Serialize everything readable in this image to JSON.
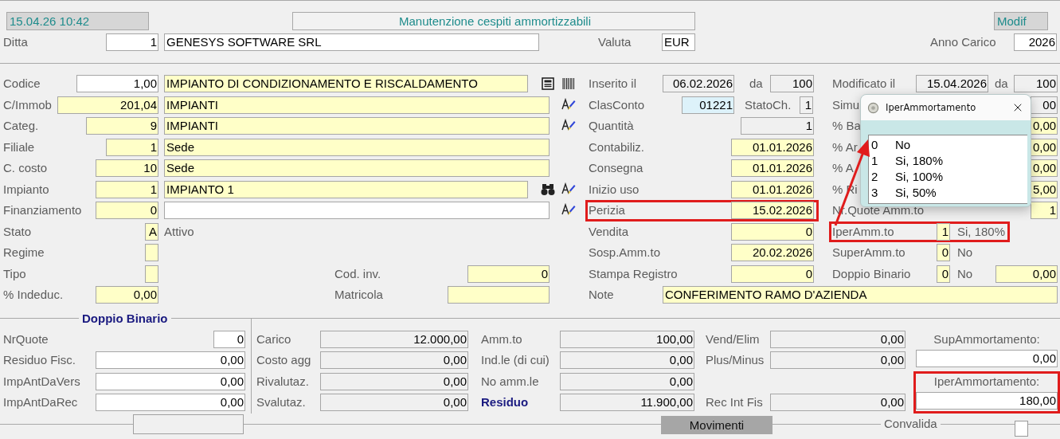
{
  "header": {
    "timestamp": "15.04.26 10:42",
    "title": "Manutenzione cespiti ammortizzabili",
    "mode": "Modif"
  },
  "company": {
    "label": "Ditta",
    "code": "1",
    "name": "GENESYS SOFTWARE SRL",
    "currency_label": "Valuta",
    "currency": "EUR",
    "year_label": "Anno Carico",
    "year": "2026"
  },
  "rows": [
    {
      "left": {
        "highlighted": false,
        "items": [
          {
            "kind": "label",
            "text": "Codice"
          },
          {
            "kind": "key_field",
            "value": "1,00"
          },
          {
            "kind": "input_field",
            "value": "IMPIANTO DI CONDIZIONAMENTO E RISCALDAMENTO"
          },
          {
            "kind": "detail_button"
          },
          {
            "kind": "barcode_button"
          }
        ]
      },
      "middle": {
        "highlighted": false,
        "items": [
          {
            "kind": "label",
            "text": "Inserito il"
          },
          {
            "kind": "readonly_field",
            "value": "06.02.2026"
          },
          {
            "kind": "label",
            "text": "da"
          },
          {
            "kind": "readonly_field",
            "value": "100"
          }
        ]
      },
      "right": {
        "highlighted": false,
        "items": [
          {
            "kind": "label",
            "text": "Modificato il"
          },
          {
            "kind": "readonly_field",
            "value": "15.04.2026"
          },
          {
            "kind": "label",
            "text": "da"
          },
          {
            "kind": "readonly_field",
            "value": "100"
          }
        ]
      }
    },
    {
      "left": {
        "highlighted": false,
        "items": [
          {
            "kind": "label",
            "text": "C/Immob"
          },
          {
            "kind": "input_field",
            "value": "201,04"
          },
          {
            "kind": "input_field",
            "value": "IMPIANTI"
          },
          {
            "kind": "lookup_button"
          }
        ]
      },
      "middle": {
        "highlighted": false,
        "items": [
          {
            "kind": "label",
            "text": "ClasConto"
          },
          {
            "kind": "linked_field",
            "value": "01221"
          },
          {
            "kind": "label",
            "text": "StatoCh."
          },
          {
            "kind": "readonly_field",
            "value": "1"
          }
        ]
      },
      "right": {
        "highlighted": false,
        "items": [
          {
            "kind": "label",
            "text": "Simu"
          },
          {
            "kind": "readonly_field",
            "value": "00"
          }
        ]
      }
    },
    {
      "left": {
        "highlighted": false,
        "items": [
          {
            "kind": "label",
            "text": "Categ."
          },
          {
            "kind": "input_field",
            "value": "9"
          },
          {
            "kind": "input_field",
            "value": "IMPIANTI"
          },
          {
            "kind": "lookup_button"
          }
        ]
      },
      "middle": {
        "highlighted": false,
        "items": [
          {
            "kind": "label",
            "text": "Quantità"
          },
          {
            "kind": "readonly_field",
            "value": "1"
          }
        ]
      },
      "right": {
        "highlighted": false,
        "items": [
          {
            "kind": "label",
            "text": "% Ba"
          },
          {
            "kind": "input_field",
            "value": "0,00"
          }
        ]
      }
    },
    {
      "left": {
        "highlighted": false,
        "items": [
          {
            "kind": "label",
            "text": "Filiale"
          },
          {
            "kind": "input_field",
            "value": "1"
          },
          {
            "kind": "input_field",
            "value": "Sede"
          }
        ]
      },
      "middle": {
        "highlighted": false,
        "items": [
          {
            "kind": "label",
            "text": "Contabiliz."
          },
          {
            "kind": "input_field",
            "value": "01.01.2026"
          }
        ]
      },
      "right": {
        "highlighted": false,
        "items": [
          {
            "kind": "label",
            "text": "% Ar"
          },
          {
            "kind": "input_field",
            "value": "0,00"
          }
        ]
      }
    },
    {
      "left": {
        "highlighted": false,
        "items": [
          {
            "kind": "label",
            "text": "C. costo"
          },
          {
            "kind": "input_field",
            "value": "10"
          },
          {
            "kind": "input_field",
            "value": "Sede"
          }
        ]
      },
      "middle": {
        "highlighted": false,
        "items": [
          {
            "kind": "label",
            "text": "Consegna"
          },
          {
            "kind": "input_field",
            "value": "01.01.2026"
          }
        ]
      },
      "right": {
        "highlighted": false,
        "items": [
          {
            "kind": "label",
            "text": "% A"
          },
          {
            "kind": "input_field",
            "value": "0,00"
          }
        ]
      }
    },
    {
      "left": {
        "highlighted": false,
        "items": [
          {
            "kind": "label",
            "text": "Impianto"
          },
          {
            "kind": "input_field",
            "value": "1"
          },
          {
            "kind": "input_field",
            "value": "IMPIANTO 1"
          },
          {
            "kind": "search_button"
          },
          {
            "kind": "lookup_button"
          }
        ]
      },
      "middle": {
        "highlighted": false,
        "items": [
          {
            "kind": "label",
            "text": "Inizio uso"
          },
          {
            "kind": "input_field",
            "value": "01.01.2026"
          }
        ]
      },
      "right": {
        "highlighted": false,
        "items": [
          {
            "kind": "label",
            "text": "% Ri"
          },
          {
            "kind": "input_field",
            "value": "5,00"
          }
        ]
      }
    },
    {
      "left": {
        "highlighted": false,
        "items": [
          {
            "kind": "label",
            "text": "Finanziamento"
          },
          {
            "kind": "input_field",
            "value": "0"
          },
          {
            "kind": "key_field"
          },
          {
            "kind": "lookup_button"
          }
        ]
      },
      "middle": {
        "highlighted": true,
        "items": [
          {
            "kind": "label",
            "text": "Perizia"
          },
          {
            "kind": "input_field",
            "value": "15.02.2026"
          }
        ]
      },
      "right": {
        "highlighted": false,
        "items": [
          {
            "kind": "label",
            "text": "Nr.Quote Amm.to"
          },
          {
            "kind": "input_field",
            "value": "1"
          }
        ]
      }
    },
    {
      "left": {
        "highlighted": false,
        "items": [
          {
            "kind": "label",
            "text": "Stato"
          },
          {
            "kind": "input_field",
            "value": "A"
          },
          {
            "kind": "text",
            "text": "Attivo"
          }
        ]
      },
      "middle": {
        "highlighted": false,
        "items": [
          {
            "kind": "label",
            "text": "Vendita"
          },
          {
            "kind": "input_field",
            "value": "0"
          }
        ]
      },
      "right": {
        "highlighted": true,
        "items": [
          {
            "kind": "label",
            "text": "IperAmm.to"
          },
          {
            "kind": "input_field",
            "value": "1"
          },
          {
            "kind": "text",
            "text": "Si, 180%"
          }
        ]
      }
    },
    {
      "left": {
        "highlighted": false,
        "items": [
          {
            "kind": "label",
            "text": "Regime"
          },
          {
            "kind": "input_field"
          }
        ]
      },
      "middle": {
        "highlighted": false,
        "items": [
          {
            "kind": "label",
            "text": "Sosp.Amm.to"
          },
          {
            "kind": "input_field",
            "value": "20.02.2026"
          }
        ]
      },
      "right": {
        "highlighted": false,
        "items": [
          {
            "kind": "label",
            "text": "SuperAmm.to"
          },
          {
            "kind": "input_field",
            "value": "0"
          },
          {
            "kind": "text",
            "text": "No"
          }
        ]
      }
    },
    {
      "left": {
        "highlighted": false,
        "items": [
          {
            "kind": "label",
            "text": "Tipo"
          },
          {
            "kind": "input_field"
          },
          {
            "kind": "label",
            "text": "Cod. inv."
          },
          {
            "kind": "input_field",
            "value": "0"
          }
        ]
      },
      "middle": {
        "highlighted": false,
        "items": [
          {
            "kind": "label",
            "text": "Stampa Registro"
          },
          {
            "kind": "input_field",
            "value": "0"
          }
        ]
      },
      "right": {
        "highlighted": false,
        "items": [
          {
            "kind": "label",
            "text": "Doppio Binario"
          },
          {
            "kind": "input_field",
            "value": "0"
          },
          {
            "kind": "text",
            "text": "No"
          },
          {
            "kind": "input_field",
            "value": "0,00"
          }
        ]
      }
    },
    {
      "left": {
        "highlighted": false,
        "items": [
          {
            "kind": "label",
            "text": "% Indeduc."
          },
          {
            "kind": "input_field",
            "value": "0,00"
          },
          {
            "kind": "label",
            "text": "Matricola"
          },
          {
            "kind": "input_field"
          }
        ]
      },
      "middle": {
        "highlighted": false,
        "items": [
          {
            "kind": "label",
            "text": "Note"
          },
          {
            "kind": "input_field",
            "value": "CONFERIMENTO RAMO D'AZIENDA"
          }
        ]
      }
    }
  ],
  "doppio_binario": {
    "legend": "Doppio Binario",
    "rows": [
      {
        "label": "NrQuote",
        "value": "0"
      },
      {
        "label": "Residuo Fisc.",
        "value": "0,00"
      },
      {
        "label": "ImpAntDaVers",
        "value": "0,00"
      },
      {
        "label": "ImpAntDaRec",
        "value": "0,00"
      }
    ]
  },
  "values": {
    "rows": [
      {
        "cells": [
          {
            "label": "Carico",
            "value": "12.000,00",
            "emphasis": false
          },
          {
            "label": "Amm.to",
            "value": "100,00",
            "emphasis": false
          },
          {
            "label": "Vend/Elim",
            "value": "0,00",
            "emphasis": false
          }
        ]
      },
      {
        "cells": [
          {
            "label": "Costo agg",
            "value": "0,00",
            "emphasis": false
          },
          {
            "label": "Ind.le (di cui)",
            "value": "0,00",
            "emphasis": false
          },
          {
            "label": "Plus/Minus",
            "value": "0,00",
            "emphasis": false
          }
        ]
      },
      {
        "cells": [
          {
            "label": "Rivalutaz.",
            "value": "0,00",
            "emphasis": false
          },
          {
            "label": "No amm.le",
            "value": "0,00",
            "emphasis": false
          }
        ]
      },
      {
        "cells": [
          {
            "label": "Svalutaz.",
            "value": "0,00",
            "emphasis": false
          },
          {
            "label": "Residuo",
            "value": "11.900,00",
            "emphasis": true
          },
          {
            "label": "Rec Int Fis",
            "value": "0,00",
            "emphasis": false
          }
        ]
      }
    ]
  },
  "amortization_totals": [
    {
      "caption": "SupAmmortamento:",
      "value": "0,00",
      "highlighted": false
    },
    {
      "caption": "IperAmmortamento:",
      "value": "180,00",
      "highlighted": true
    }
  ],
  "footer": {
    "button": "Movimenti",
    "checkbox_label": "Convalida",
    "checked": false
  },
  "popup": {
    "title": "IperAmmortamento",
    "pointer_arrow": true,
    "options": [
      {
        "code": "0",
        "label": "No",
        "selected": false
      },
      {
        "code": "1",
        "label": "Si, 180%",
        "selected": false
      },
      {
        "code": "2",
        "label": "Si, 100%",
        "selected": false
      },
      {
        "code": "3",
        "label": "Si, 50%",
        "selected": false
      }
    ]
  }
}
